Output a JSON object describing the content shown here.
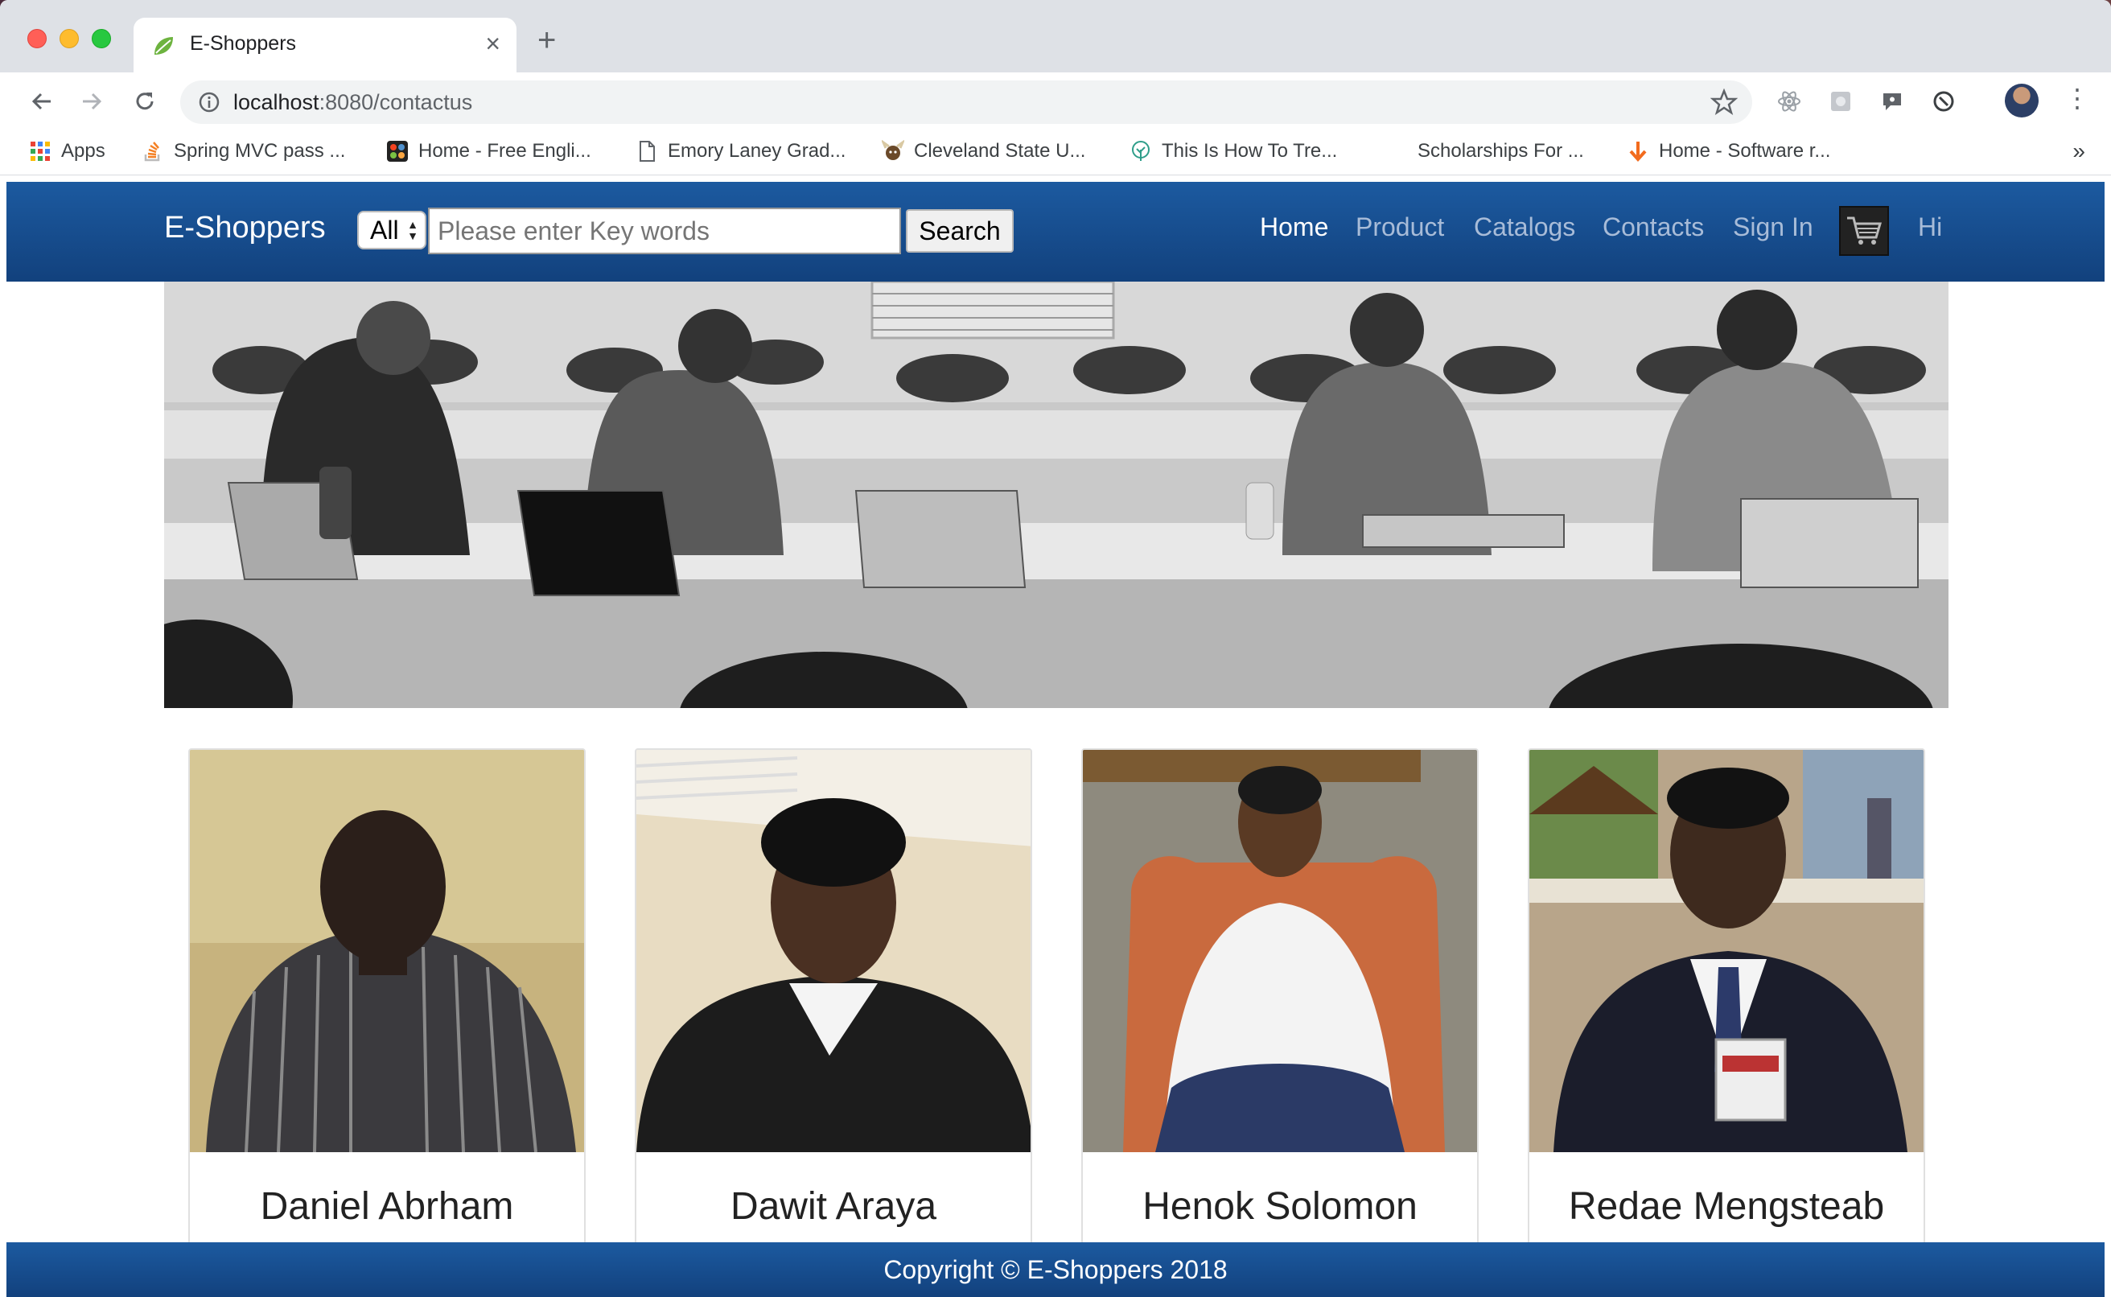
{
  "browser": {
    "tab_title": "E-Shoppers",
    "url_host": "localhost",
    "url_path": ":8080/contactus",
    "bookmarks": [
      {
        "label": "Apps",
        "icon": "apps-grid-icon"
      },
      {
        "label": "Spring MVC pass ...",
        "icon": "stackoverflow-icon"
      },
      {
        "label": "Home - Free Engli...",
        "icon": "joomla-icon"
      },
      {
        "label": "Emory Laney Grad...",
        "icon": "document-icon"
      },
      {
        "label": "Cleveland State U...",
        "icon": "viking-icon"
      },
      {
        "label": "This Is How To Tre...",
        "icon": "tree-icon"
      },
      {
        "label": "Scholarships For ...",
        "icon": ""
      },
      {
        "label": "Home - Software r...",
        "icon": "down-arrow-icon"
      }
    ],
    "bookmarks_more": "»"
  },
  "navbar": {
    "brand": "E-Shoppers",
    "category_selected": "All",
    "search_placeholder": "Please enter Key words",
    "search_button": "Search",
    "links": [
      "Home",
      "Product",
      "Catalogs",
      "Contacts",
      "Sign In"
    ],
    "active_link": "Home",
    "greeting": "Hi"
  },
  "team": [
    {
      "name": "Daniel Abrham"
    },
    {
      "name": "Dawit Araya"
    },
    {
      "name": "Henok Solomon"
    },
    {
      "name": "Redae Mengsteab"
    }
  ],
  "footer": {
    "copyright": "Copyright © E-Shoppers 2018"
  },
  "colors": {
    "navbar": "#1c5aa0",
    "footer": "#12417d",
    "nav_inactive": "#a8bcd8"
  }
}
